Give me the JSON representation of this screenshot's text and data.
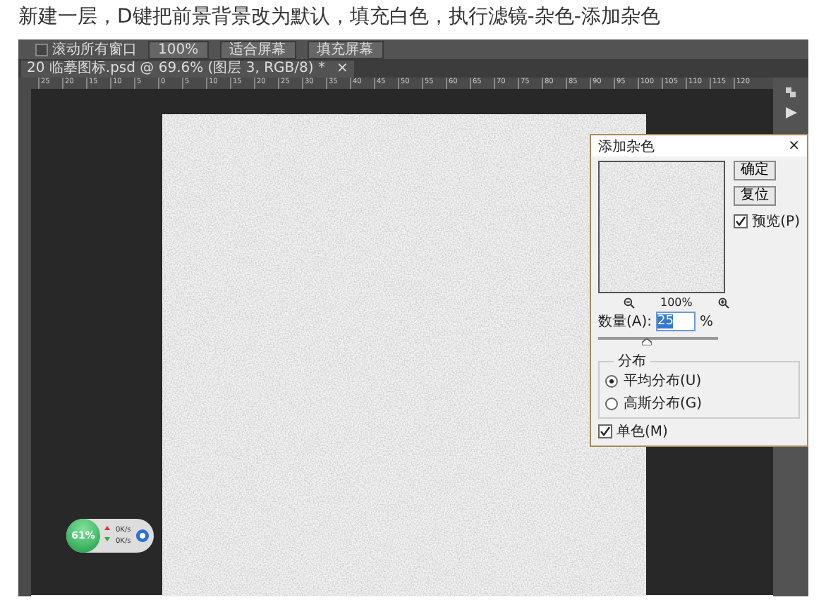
{
  "post_text": "新建一层，D键把前景背景改为默认，填充白色，执行滤镜-杂色-添加杂色",
  "options_bar": {
    "scroll_all": {
      "label": "滚动所有窗口",
      "checked": false
    },
    "buttons": [
      "100%",
      "适合屏幕",
      "填充屏幕"
    ]
  },
  "document_tab": {
    "title": "20 临摹图标.psd @ 69.6% (图层 3, RGB/8) *",
    "close": "×"
  },
  "ruler_labels": [
    "25",
    "20",
    "15",
    "10",
    "5",
    "0",
    "5",
    "10",
    "15",
    "20",
    "25",
    "30",
    "35",
    "40",
    "45",
    "50",
    "55",
    "60",
    "65",
    "70",
    "75",
    "80",
    "85",
    "90",
    "95",
    "100",
    "105",
    "110",
    "115",
    "120"
  ],
  "dialog": {
    "title": "添加杂色",
    "close": "×",
    "buttons": [
      "确定",
      "复位"
    ],
    "preview": {
      "label": "预览(P)",
      "checked": true
    },
    "zoom": "100%",
    "amount": {
      "label": "数量(A):",
      "value": "25",
      "unit": "%",
      "level": 0.4
    },
    "distribution": {
      "label": "分布",
      "options": [
        {
          "label": "平均分布(U)",
          "selected": true
        },
        {
          "label": "高斯分布(G)",
          "selected": false
        }
      ]
    },
    "monochromatic": {
      "label": "单色(M)",
      "checked": true
    }
  },
  "net_widget": {
    "percent": "61%",
    "upload": "0K/s",
    "download": "0K/s"
  }
}
